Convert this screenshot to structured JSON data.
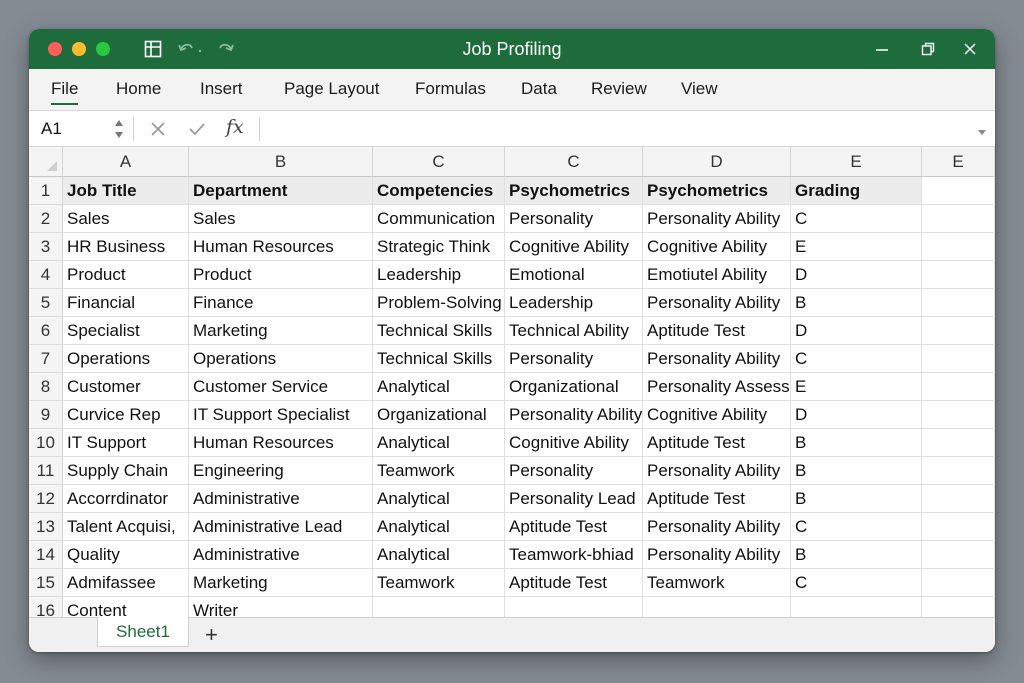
{
  "window": {
    "title": "Job Profiling"
  },
  "colors": {
    "titlebar": "#1e6b3c",
    "accent": "#1e6b3c",
    "close": "#fe5f57",
    "minimize": "#febc2e",
    "maximize": "#28c840"
  },
  "ribbon": {
    "tabs": [
      "File",
      "Home",
      "Insert",
      "Page Layout",
      "Formulas",
      "Data",
      "Review",
      "View"
    ],
    "active": "File"
  },
  "formula_bar": {
    "name_box": "A1",
    "fx": "fx",
    "value": ""
  },
  "grid": {
    "columns": [
      "A",
      "B",
      "C",
      "C",
      "D",
      "E",
      "E"
    ],
    "rows": [
      {
        "num": "1",
        "cells": [
          "Job Title",
          "Department",
          "Competencies",
          "Psychometrics",
          "Psychometrics",
          "Grading",
          ""
        ]
      },
      {
        "num": "2",
        "cells": [
          "Sales",
          "Sales",
          "Communication",
          "Personality",
          "Personality Ability",
          "C",
          ""
        ]
      },
      {
        "num": "3",
        "cells": [
          "HR Business",
          "Human Resources",
          "Strategic Think",
          "Cognitive Ability",
          "Cognitive  Ability",
          "E",
          ""
        ]
      },
      {
        "num": "4",
        "cells": [
          "Product",
          "Product",
          "Leadership",
          "Emotional",
          "Emotiutel Ability",
          "D",
          ""
        ]
      },
      {
        "num": "5",
        "cells": [
          "Financial",
          "Finance",
          "Problem-Solving",
          "Leadership",
          "Personality Ability",
          "B",
          ""
        ]
      },
      {
        "num": "6",
        "cells": [
          "Specialist",
          "Marketing",
          "Technical Skills",
          "Technical Ability",
          "Aptitude Test",
          "D",
          ""
        ]
      },
      {
        "num": "7",
        "cells": [
          "Operations",
          "Operations",
          "Technical Skills",
          "Personality",
          "Personality Ability",
          "C",
          ""
        ]
      },
      {
        "num": "8",
        "cells": [
          "Customer",
          "Customer Service",
          "Analytical",
          "Organizational",
          "Personality Assess",
          "E",
          ""
        ]
      },
      {
        "num": "9",
        "cells": [
          "Curvice Rep",
          "IT Support Specialist",
          "Organizational",
          "Personality Ability",
          "Cognitive Ability",
          "D",
          ""
        ]
      },
      {
        "num": "10",
        "cells": [
          "IT Support",
          "Human Resources",
          "Analytical",
          "Cognitive Ability",
          "Aptitude Test",
          "B",
          ""
        ]
      },
      {
        "num": "11",
        "cells": [
          "Supply Chain",
          "Engineering",
          "Teamwork",
          "Personality",
          "Personality Ability",
          "B",
          ""
        ]
      },
      {
        "num": "12",
        "cells": [
          "Accorrdinator",
          "Administrative",
          "Analytical",
          "Personality Lead",
          "Aptitude Test",
          "B",
          ""
        ]
      },
      {
        "num": "13",
        "cells": [
          "Talent Acquisi,",
          "Administrative Lead",
          "Analytical",
          "Aptitude Test",
          "Personality Ability",
          "C",
          ""
        ]
      },
      {
        "num": "14",
        "cells": [
          "Quality",
          "Administrative",
          "Analytical",
          "Teamwork-bhiad",
          "Personality Ability",
          "B",
          ""
        ]
      },
      {
        "num": "15",
        "cells": [
          "Admifassee",
          "Marketing",
          "Teamwork",
          "Aptitude Test",
          "Teamwork",
          "C",
          ""
        ]
      },
      {
        "num": "16",
        "cells": [
          "Content",
          "Writer",
          "",
          "",
          "",
          "",
          ""
        ]
      }
    ]
  },
  "sheets": {
    "tabs": [
      "Sheet1"
    ],
    "add_label": "+"
  }
}
